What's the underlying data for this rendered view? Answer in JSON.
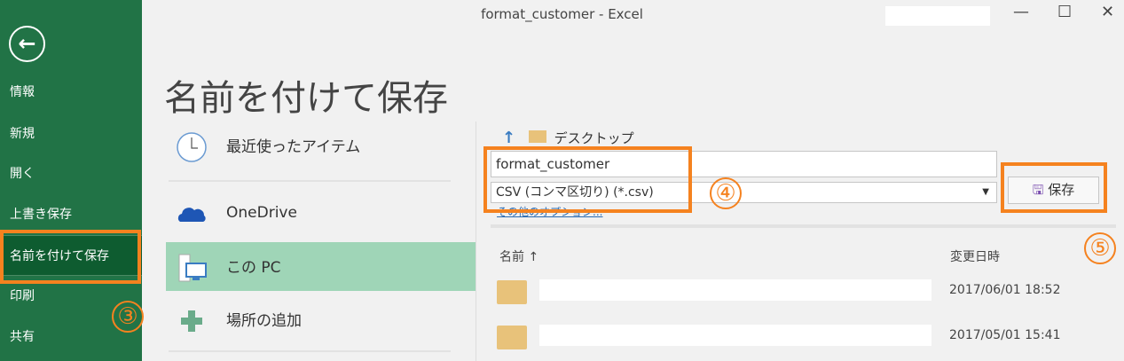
{
  "window": {
    "title": "format_customer  -  Excel",
    "minimize": "—",
    "maximize": "☐",
    "close": "✕"
  },
  "sidebar": {
    "back": "←",
    "items": [
      {
        "label": "情報"
      },
      {
        "label": "新規"
      },
      {
        "label": "開く"
      },
      {
        "label": "上書き保存"
      },
      {
        "label": "名前を付けて保存"
      },
      {
        "label": "印刷"
      },
      {
        "label": "共有"
      }
    ]
  },
  "page_title": "名前を付けて保存",
  "locations": [
    {
      "label": "最近使ったアイテム"
    },
    {
      "label": "OneDrive"
    },
    {
      "label": "この PC"
    },
    {
      "label": "場所の追加"
    }
  ],
  "path": {
    "folder": "デスクトップ"
  },
  "filename": "format_customer",
  "filetype": "CSV (コンマ区切り) (*.csv)",
  "more_options": "その他のオプション...",
  "save_label": "保存",
  "columns": {
    "name": "名前 ↑",
    "modified": "変更日時"
  },
  "files": [
    {
      "modified": "2017/06/01 18:52"
    },
    {
      "modified": "2017/05/01 15:41"
    }
  ],
  "annotations": {
    "step3": "③",
    "step4": "④",
    "step5": "⑤"
  },
  "colors": {
    "accent": "#217346",
    "highlight": "#f5821f",
    "selected": "#9fd5b7"
  }
}
